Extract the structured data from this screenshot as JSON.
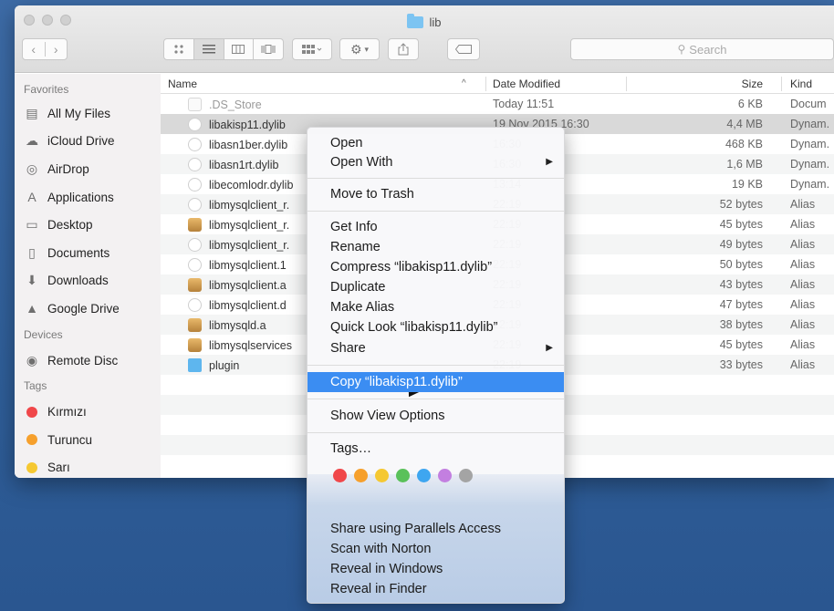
{
  "window": {
    "title": "lib"
  },
  "toolbar": {
    "back": "‹",
    "forward": "›",
    "search_placeholder": "Search"
  },
  "sidebar": {
    "favorites_header": "Favorites",
    "favorites": [
      {
        "label": "All My Files",
        "icon": "all-files-icon"
      },
      {
        "label": "iCloud Drive",
        "icon": "cloud-icon"
      },
      {
        "label": "AirDrop",
        "icon": "airdrop-icon"
      },
      {
        "label": "Applications",
        "icon": "applications-icon"
      },
      {
        "label": "Desktop",
        "icon": "desktop-icon"
      },
      {
        "label": "Documents",
        "icon": "documents-icon"
      },
      {
        "label": "Downloads",
        "icon": "downloads-icon"
      },
      {
        "label": "Google Drive",
        "icon": "google-drive-icon"
      }
    ],
    "devices_header": "Devices",
    "devices": [
      {
        "label": "Remote Disc",
        "icon": "disc-icon"
      }
    ],
    "tags_header": "Tags",
    "tags": [
      {
        "label": "Kırmızı",
        "color": "#f0474a"
      },
      {
        "label": "Turuncu",
        "color": "#f6a02c"
      },
      {
        "label": "Sarı",
        "color": "#f5c832"
      }
    ]
  },
  "columns": {
    "name": "Name",
    "date": "Date Modified",
    "size": "Size",
    "kind": "Kind"
  },
  "files": [
    {
      "name": ".DS_Store",
      "date": "Today 11:51",
      "size": "6 KB",
      "kind": "Docum",
      "type": "doc",
      "dim": true
    },
    {
      "name": "libakisp11.dylib",
      "date": "19 Nov 2015 16:30",
      "size": "4,4 MB",
      "kind": "Dynam.",
      "type": "dylib",
      "selected": true
    },
    {
      "name": "libasn1ber.dylib",
      "date": "16:30",
      "size": "468 KB",
      "kind": "Dynam.",
      "type": "dylib"
    },
    {
      "name": "libasn1rt.dylib",
      "date": "16:30",
      "size": "1,6 MB",
      "kind": "Dynam.",
      "type": "dylib"
    },
    {
      "name": "libecomlodr.dylib",
      "date": "13:14",
      "size": "19 KB",
      "kind": "Dynam.",
      "type": "dylib"
    },
    {
      "name": "libmysqlclient_r.",
      "date": "22:19",
      "size": "52 bytes",
      "kind": "Alias",
      "type": "alias"
    },
    {
      "name": "libmysqlclient_r.",
      "date": "22:19",
      "size": "45 bytes",
      "kind": "Alias",
      "type": "lib"
    },
    {
      "name": "libmysqlclient_r.",
      "date": "22:19",
      "size": "49 bytes",
      "kind": "Alias",
      "type": "alias"
    },
    {
      "name": "libmysqlclient.1",
      "date": "22:19",
      "size": "50 bytes",
      "kind": "Alias",
      "type": "alias"
    },
    {
      "name": "libmysqlclient.a",
      "date": "22:19",
      "size": "43 bytes",
      "kind": "Alias",
      "type": "lib"
    },
    {
      "name": "libmysqlclient.d",
      "date": "22:19",
      "size": "47 bytes",
      "kind": "Alias",
      "type": "alias"
    },
    {
      "name": "libmysqld.a",
      "date": "22:19",
      "size": "38 bytes",
      "kind": "Alias",
      "type": "lib"
    },
    {
      "name": "libmysqlservices",
      "date": "22:19",
      "size": "45 bytes",
      "kind": "Alias",
      "type": "lib"
    },
    {
      "name": "plugin",
      "date": "22:19",
      "size": "33 bytes",
      "kind": "Alias",
      "type": "folder"
    }
  ],
  "menu": {
    "open": "Open",
    "open_with": "Open With",
    "move_to_trash": "Move to Trash",
    "get_info": "Get Info",
    "rename": "Rename",
    "compress": "Compress “libakisp11.dylib”",
    "duplicate": "Duplicate",
    "make_alias": "Make Alias",
    "quick_look": "Quick Look “libakisp11.dylib”",
    "share": "Share",
    "copy": "Copy “libakisp11.dylib”",
    "show_view_options": "Show View Options",
    "tags": "Tags…",
    "tag_colors": [
      "#f0474a",
      "#f6a02c",
      "#f5c832",
      "#5ac15a",
      "#3ea6f0",
      "#c37fe0",
      "#a4a4a4"
    ],
    "share_parallels": "Share using Parallels Access",
    "scan_norton": "Scan with Norton",
    "reveal_windows": "Reveal in Windows",
    "reveal_finder": "Reveal in Finder",
    "submenu_arrow": "▶"
  }
}
